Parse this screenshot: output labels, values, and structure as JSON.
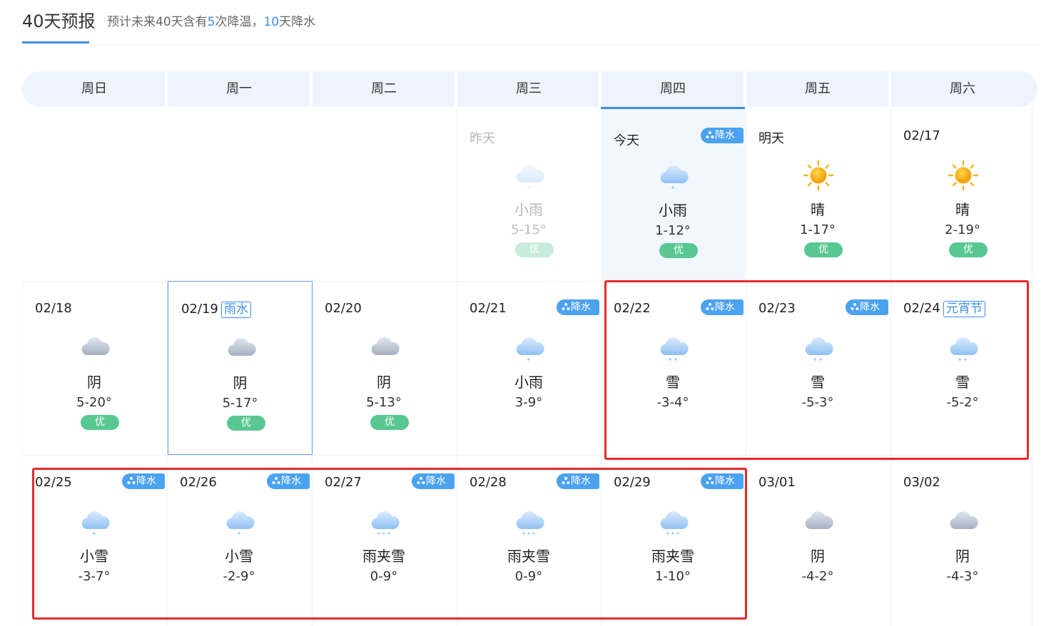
{
  "header": {
    "title": "40天预报",
    "summary_prefix": "预计未来40天含有",
    "cooling_count": "5",
    "summary_middle": "次降温，",
    "precip_count": "10",
    "summary_suffix": "天降水"
  },
  "weekdays": [
    "周日",
    "周一",
    "周二",
    "周三",
    "周四",
    "周五",
    "周六"
  ],
  "precip_badge": "降水",
  "colors": {
    "accent": "#3d8ee6",
    "aqi_good": "#58c791",
    "highlight_box": "#e52b2b",
    "today_bg": "#f2f7fd"
  },
  "days": [
    {
      "date": "昨天",
      "icon": "light-rain-icon",
      "condition": "小雨",
      "temp": "5-15°",
      "aqi": "优",
      "precip": false,
      "festival": ""
    },
    {
      "date": "今天",
      "icon": "light-rain-icon",
      "condition": "小雨",
      "temp": "1-12°",
      "aqi": "优",
      "precip": true,
      "festival": ""
    },
    {
      "date": "明天",
      "icon": "sunny-icon",
      "condition": "晴",
      "temp": "1-17°",
      "aqi": "优",
      "precip": false,
      "festival": ""
    },
    {
      "date": "02/17",
      "icon": "sunny-icon",
      "condition": "晴",
      "temp": "2-19°",
      "aqi": "优",
      "precip": false,
      "festival": ""
    },
    {
      "date": "02/18",
      "icon": "overcast-icon",
      "condition": "阴",
      "temp": "5-20°",
      "aqi": "优",
      "precip": false,
      "festival": ""
    },
    {
      "date": "02/19",
      "icon": "overcast-icon",
      "condition": "阴",
      "temp": "5-17°",
      "aqi": "优",
      "precip": false,
      "festival": "雨水"
    },
    {
      "date": "02/20",
      "icon": "overcast-icon",
      "condition": "阴",
      "temp": "5-13°",
      "aqi": "优",
      "precip": false,
      "festival": ""
    },
    {
      "date": "02/21",
      "icon": "light-rain-icon",
      "condition": "小雨",
      "temp": "3-9°",
      "aqi": "",
      "precip": true,
      "festival": ""
    },
    {
      "date": "02/22",
      "icon": "snow-icon",
      "condition": "雪",
      "temp": "-3-4°",
      "aqi": "",
      "precip": true,
      "festival": ""
    },
    {
      "date": "02/23",
      "icon": "snow-icon",
      "condition": "雪",
      "temp": "-5-3°",
      "aqi": "",
      "precip": true,
      "festival": ""
    },
    {
      "date": "02/24",
      "icon": "snow-icon",
      "condition": "雪",
      "temp": "-5-2°",
      "aqi": "",
      "precip": false,
      "festival": "元宵节"
    },
    {
      "date": "02/25",
      "icon": "light-snow-icon",
      "condition": "小雪",
      "temp": "-3-7°",
      "aqi": "",
      "precip": true,
      "festival": ""
    },
    {
      "date": "02/26",
      "icon": "light-snow-icon",
      "condition": "小雪",
      "temp": "-2-9°",
      "aqi": "",
      "precip": true,
      "festival": ""
    },
    {
      "date": "02/27",
      "icon": "sleet-icon",
      "condition": "雨夹雪",
      "temp": "0-9°",
      "aqi": "",
      "precip": true,
      "festival": ""
    },
    {
      "date": "02/28",
      "icon": "sleet-icon",
      "condition": "雨夹雪",
      "temp": "0-9°",
      "aqi": "",
      "precip": true,
      "festival": ""
    },
    {
      "date": "02/29",
      "icon": "sleet-icon",
      "condition": "雨夹雪",
      "temp": "1-10°",
      "aqi": "",
      "precip": true,
      "festival": ""
    },
    {
      "date": "03/01",
      "icon": "overcast-icon",
      "condition": "阴",
      "temp": "-4-2°",
      "aqi": "",
      "precip": false,
      "festival": ""
    },
    {
      "date": "03/02",
      "icon": "overcast-icon",
      "condition": "阴",
      "temp": "-4-3°",
      "aqi": "",
      "precip": false,
      "festival": ""
    }
  ]
}
